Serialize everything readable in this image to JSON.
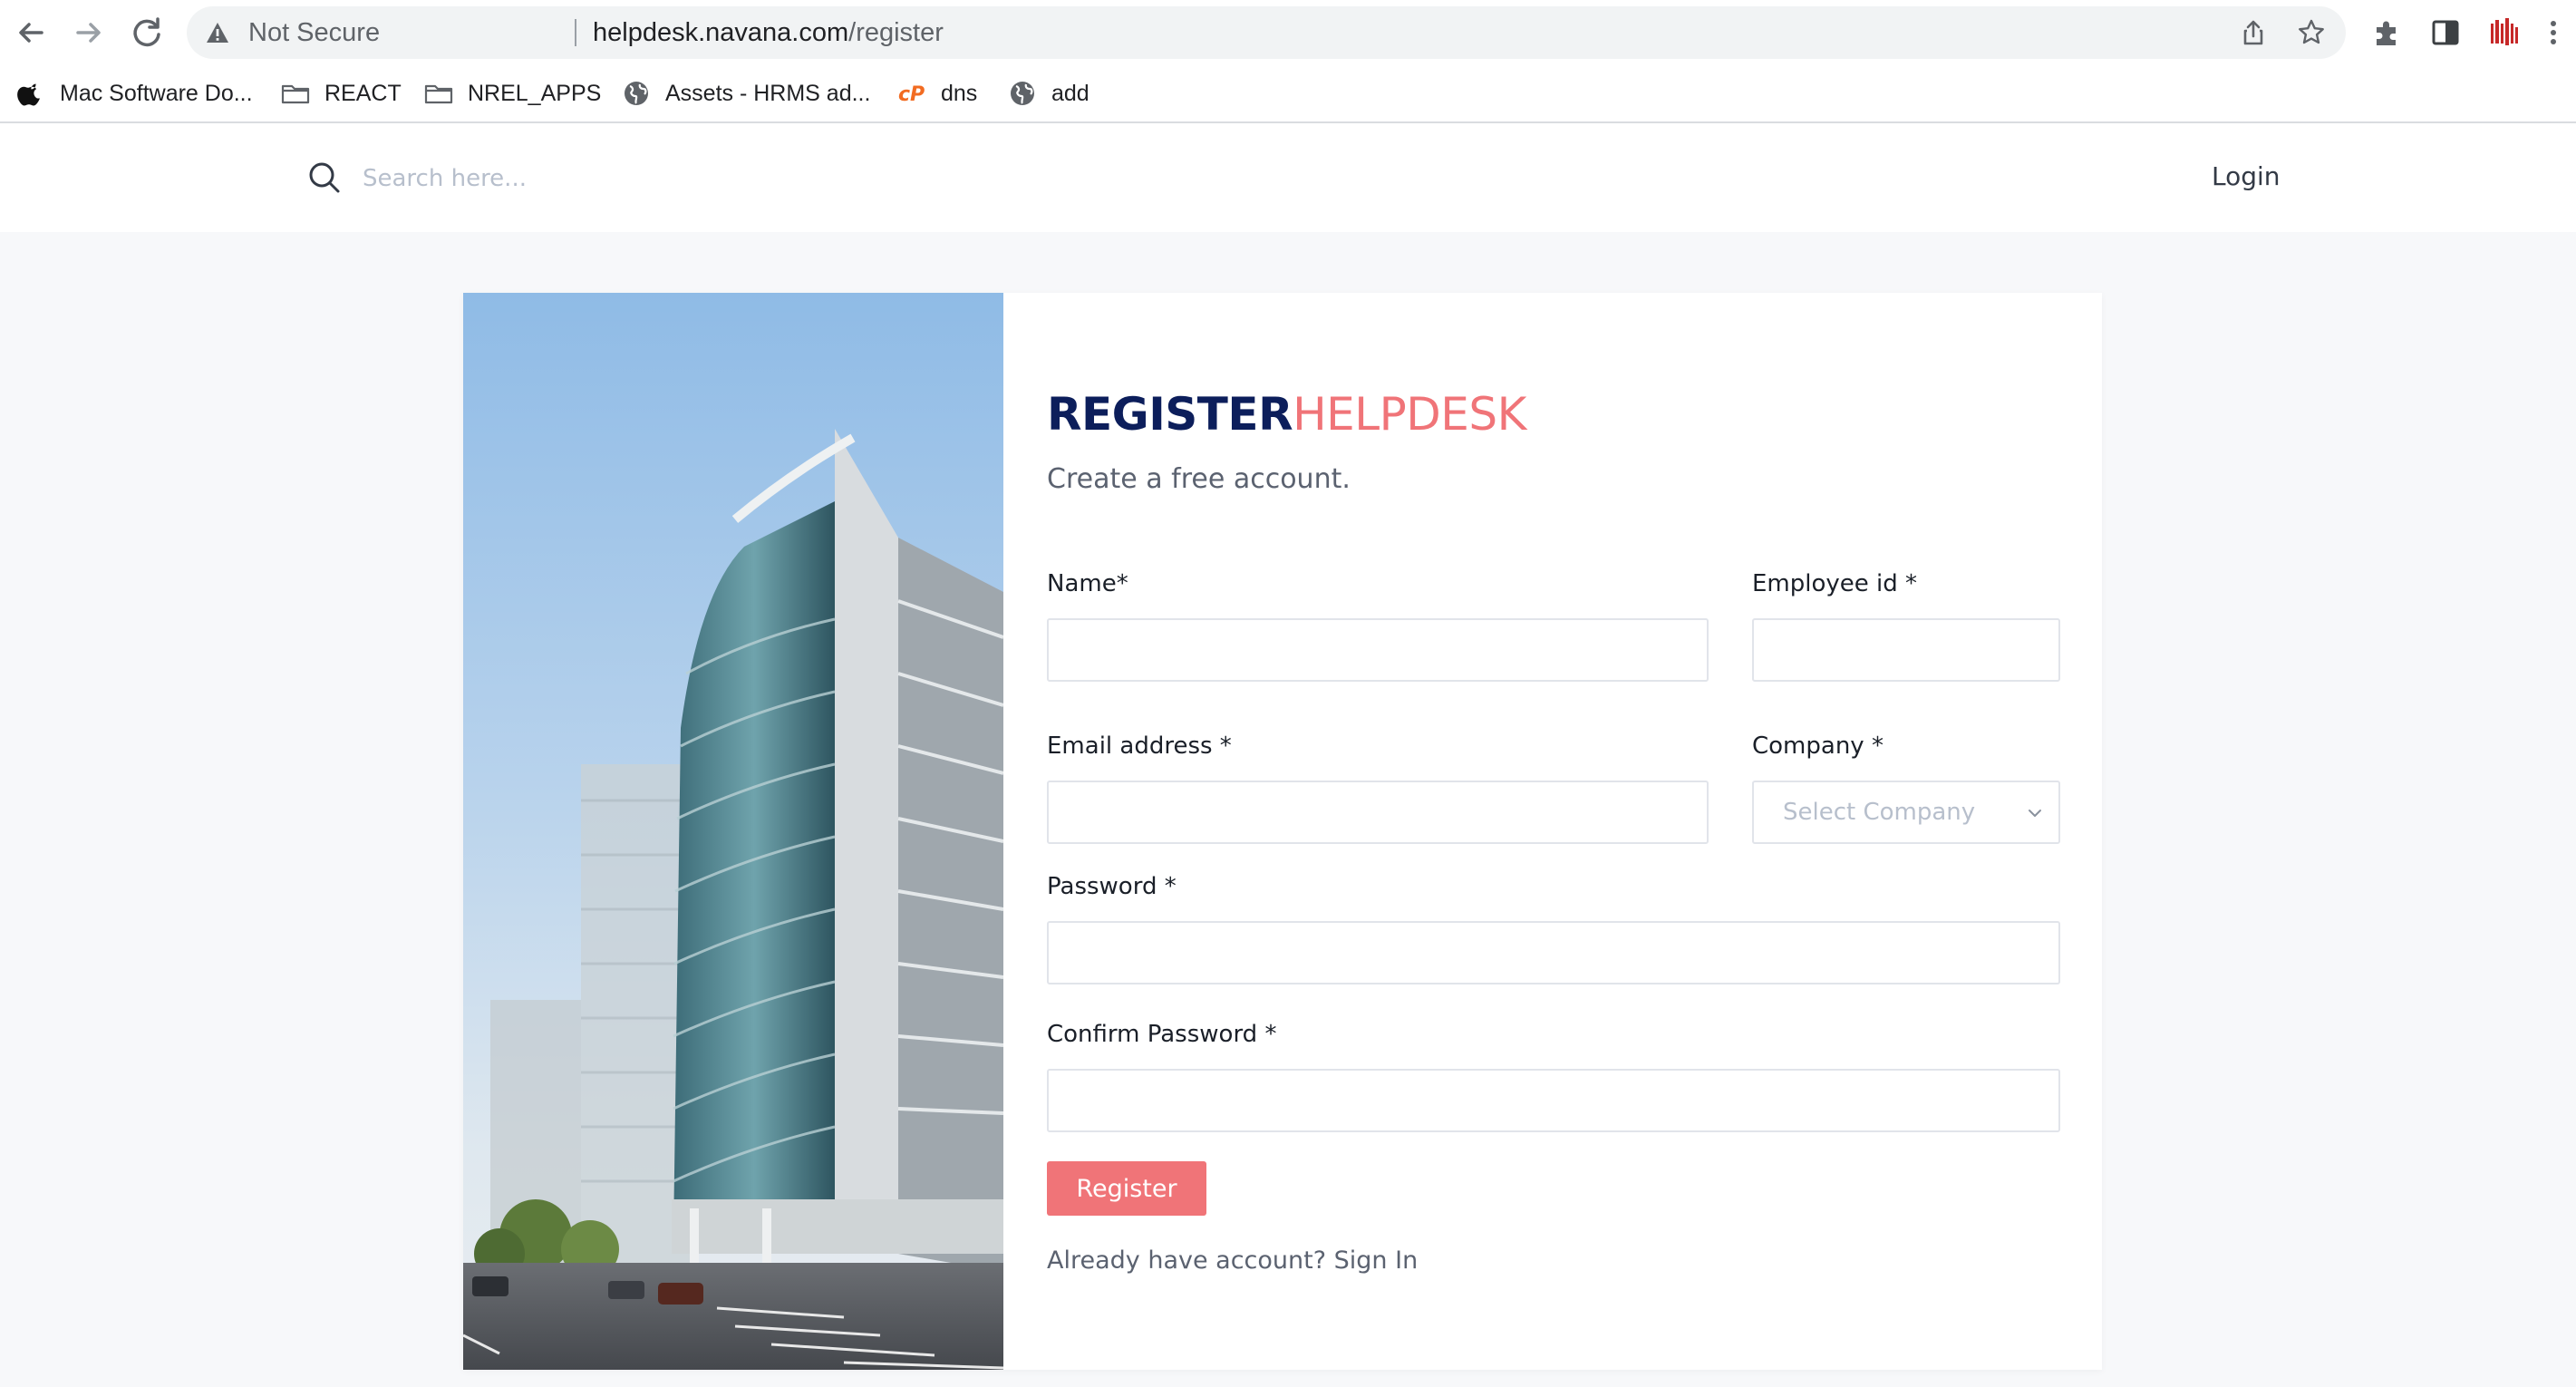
{
  "browser": {
    "security_label": "Not Secure",
    "url_host": "helpdesk.navana.com",
    "url_path": "/register"
  },
  "bookmarks": [
    {
      "label": "Mac Software Do...",
      "icon": "apple-icon"
    },
    {
      "label": "REACT",
      "icon": "folder-icon"
    },
    {
      "label": "NREL_APPS",
      "icon": "folder-icon"
    },
    {
      "label": "Assets - HRMS ad...",
      "icon": "globe-icon"
    },
    {
      "label": "dns",
      "icon": "cpanel-icon"
    },
    {
      "label": "add",
      "icon": "globe-icon"
    }
  ],
  "header": {
    "search_placeholder": "Search here...",
    "login_label": "Login"
  },
  "form": {
    "title_bold": "REGISTER",
    "title_light": "HELPDESK",
    "subtitle": "Create a free account.",
    "fields": {
      "name_label": "Name*",
      "employee_id_label": "Employee id *",
      "email_label": "Email address *",
      "company_label": "Company *",
      "company_placeholder": "Select Company",
      "password_label": "Password *",
      "confirm_password_label": "Confirm Password *"
    },
    "register_label": "Register",
    "signin_prompt": "Already have account?",
    "signin_link": "Sign In"
  },
  "colors": {
    "brand_navy": "#0c1e5b",
    "brand_coral": "#f07478"
  }
}
